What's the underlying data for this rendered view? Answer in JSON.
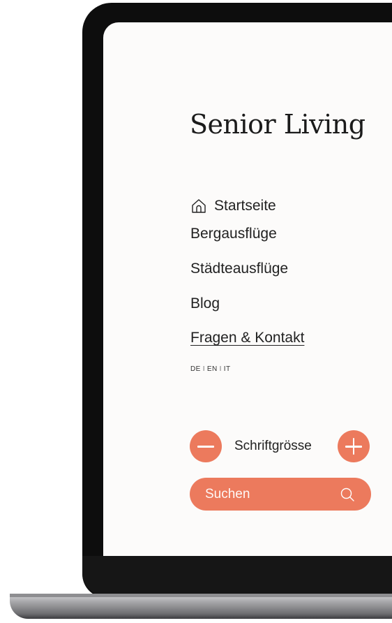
{
  "site": {
    "logo_text": "Senior Living"
  },
  "nav": {
    "items": [
      {
        "label": "Startseite",
        "icon": "home-icon"
      },
      {
        "label": "Bergausflüge"
      },
      {
        "label": "Städteausflüge"
      },
      {
        "label": "Blog"
      },
      {
        "label": "Fragen & Kontakt"
      }
    ]
  },
  "languages": {
    "items": [
      "DE",
      "EN",
      "IT"
    ],
    "separator": "I"
  },
  "font_size": {
    "label": "Schriftgrösse",
    "decrease_icon": "minus-icon",
    "increase_icon": "plus-icon"
  },
  "search": {
    "placeholder": "Suchen",
    "icon": "search-icon"
  },
  "colors": {
    "accent": "#ec7a5d",
    "text": "#222222",
    "screen_bg": "#fcfbfa",
    "bezel": "#0d0d0d"
  }
}
